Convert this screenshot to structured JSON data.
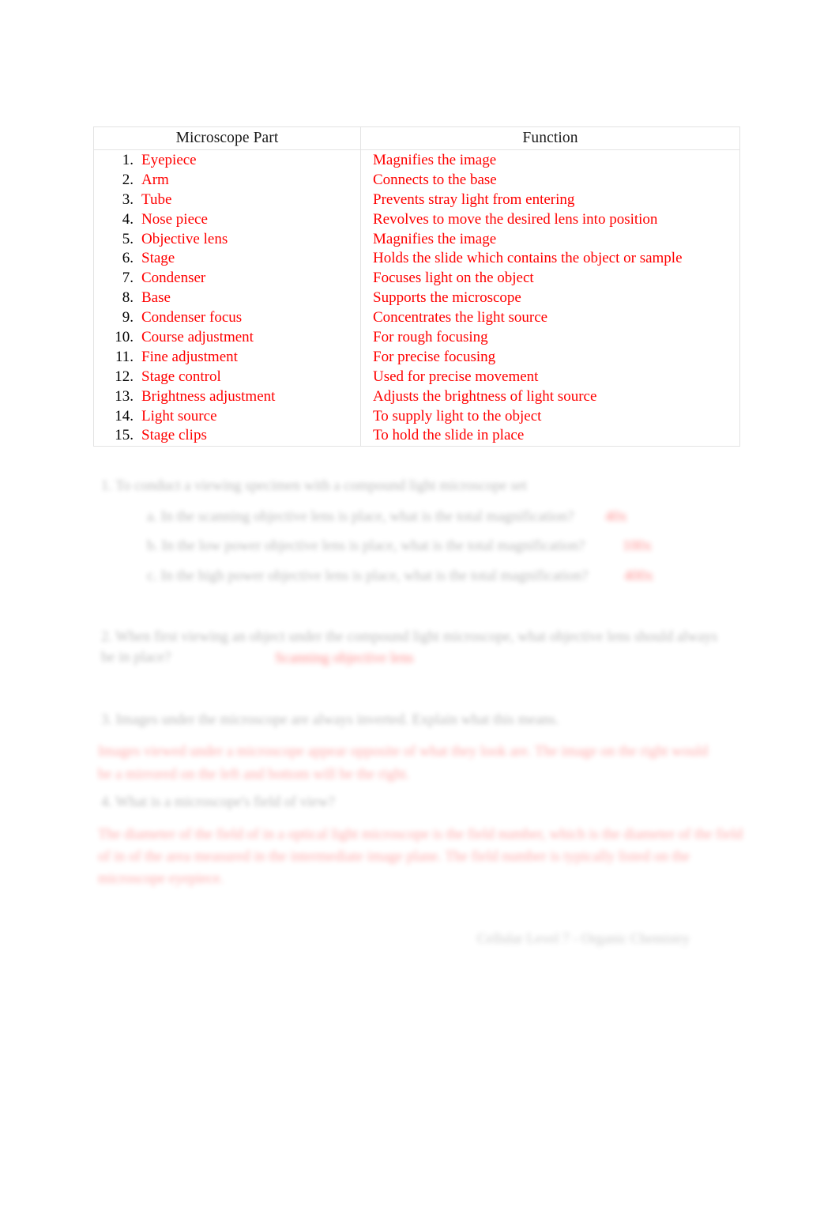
{
  "document": {
    "table": {
      "headers": [
        "Microscope Part",
        "Function"
      ],
      "rows": [
        {
          "n": "1.",
          "part": "Eyepiece",
          "function": "Magnifies the image"
        },
        {
          "n": "2.",
          "part": "Arm",
          "function": "Connects to the base"
        },
        {
          "n": "3.",
          "part": "Tube",
          "function": "Prevents stray light from entering"
        },
        {
          "n": "4.",
          "part": "Nose piece",
          "function": "Revolves to move the desired lens into position"
        },
        {
          "n": "5.",
          "part": "Objective lens",
          "function": "Magnifies the image"
        },
        {
          "n": "6.",
          "part": "Stage",
          "function": "Holds the slide which contains the object or sample"
        },
        {
          "n": "7.",
          "part": "Condenser",
          "function": "Focuses light on the object"
        },
        {
          "n": "8.",
          "part": "Base",
          "function": "Supports the microscope"
        },
        {
          "n": "9.",
          "part": "Condenser focus",
          "function": "Concentrates the light source"
        },
        {
          "n": "10.",
          "part": "Course adjustment",
          "function": "For rough focusing"
        },
        {
          "n": "11.",
          "part": "Fine adjustment",
          "function": "For precise focusing"
        },
        {
          "n": "12.",
          "part": "Stage control",
          "function": "Used for precise movement"
        },
        {
          "n": "13.",
          "part": "Brightness adjustment",
          "function": "Adjusts the brightness of light source"
        },
        {
          "n": "14.",
          "part": "Light source",
          "function": "To supply light to the object"
        },
        {
          "n": "15.",
          "part": "Stage clips",
          "function": "To hold the slide in place"
        }
      ]
    },
    "questions": [
      {
        "prompt": "1. To conduct a viewing specimen with a compound light microscope set",
        "subitems": [
          {
            "text": "a. In the scanning objective lens is place, what is the total magnification?",
            "answer": "40x"
          },
          {
            "text": "b. In the low power objective lens is place, what is the total magnification?",
            "answer": "100x"
          },
          {
            "text": "c. In the high power objective lens is place, what is the total magnification?",
            "answer": "400x"
          }
        ]
      },
      {
        "prompt": "2. When first viewing an object under the compound light microscope, what objective lens should always be in place?",
        "answer": "Scanning objective lens"
      },
      {
        "prompt": "3. Images under the microscope are always inverted. Explain what this means.",
        "answer": "Images viewed under a microscope appear opposite of what they look are. The image on the right would be a mirrored on the left and bottom will be the right."
      },
      {
        "prompt": "4. What is a microscope's field of view?",
        "answer": "The diameter of the field of in a optical light microscope is the field number, which is the diameter of the field of in of the area measured in the intermediate image plane. The field number is typically listed on the microscope eyepiece."
      }
    ],
    "footer": "Cellular Level 7 - Organic Chemistry"
  }
}
